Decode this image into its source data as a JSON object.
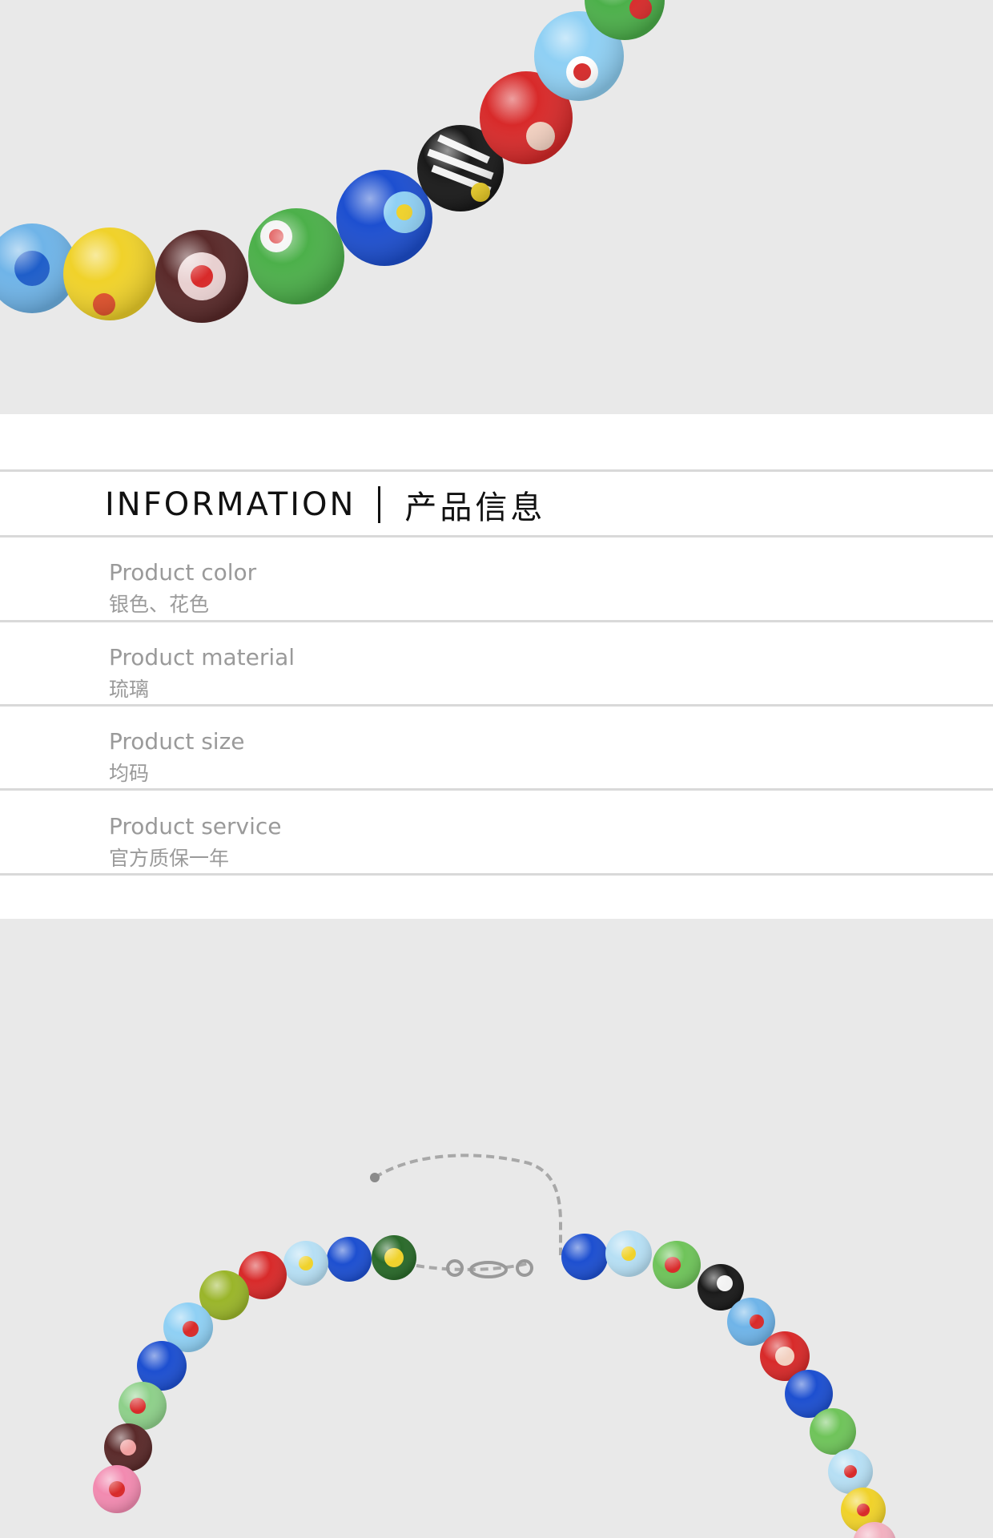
{
  "information": {
    "heading_en": "INFORMATION",
    "heading_cn": "产品信息",
    "rows": [
      {
        "label": "Product color",
        "value": "银色、花色"
      },
      {
        "label": "Product material",
        "value": "琉璃"
      },
      {
        "label": "Product size",
        "value": "均码"
      },
      {
        "label": "Product service",
        "value": "官方质保一年"
      }
    ]
  },
  "colors": {
    "photo_background": "#e9e9e9",
    "label_text": "#9a9a9a",
    "heading_text": "#111111",
    "divider": "#d9d9d9"
  }
}
